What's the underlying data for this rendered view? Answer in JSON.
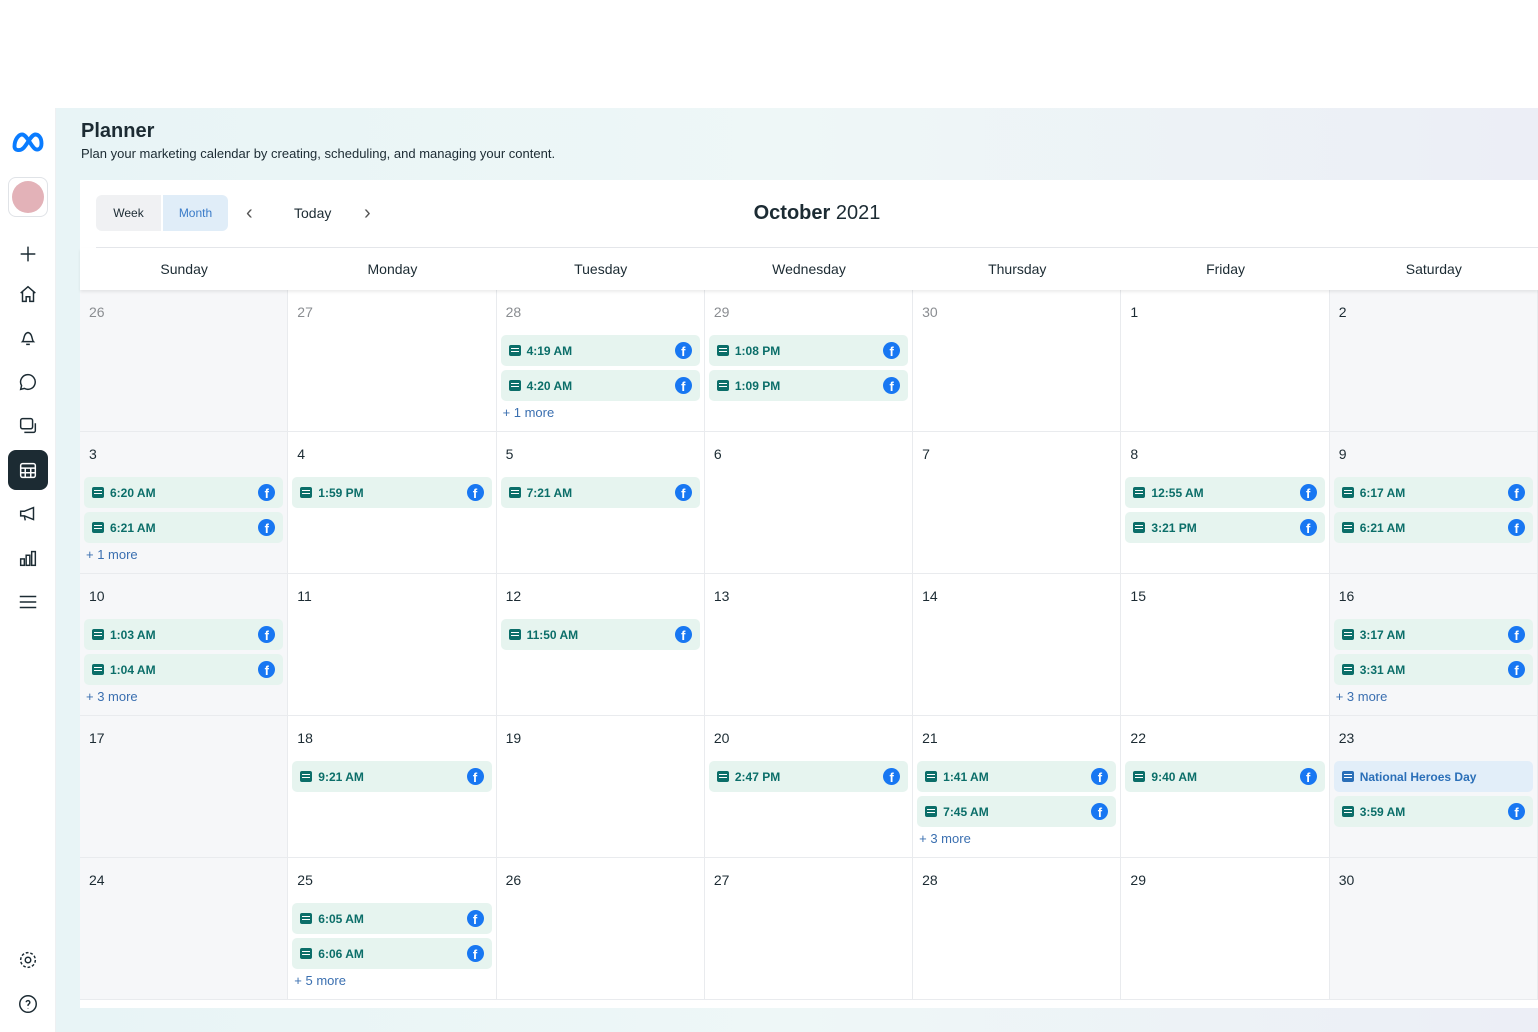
{
  "sidebar": {
    "items": [
      "meta-logo",
      "account",
      "create",
      "home",
      "notifications",
      "inbox",
      "content",
      "planner",
      "ads",
      "insights",
      "menu",
      "settings",
      "help"
    ]
  },
  "header": {
    "title": "Planner",
    "subtitle": "Plan your marketing calendar by creating, scheduling, and managing your content."
  },
  "toolbar": {
    "week": "Week",
    "month": "Month",
    "today": "Today",
    "month_name": "October",
    "year": "2021"
  },
  "days_of_week": [
    "Sunday",
    "Monday",
    "Tuesday",
    "Wednesday",
    "Thursday",
    "Friday",
    "Saturday"
  ],
  "weeks": [
    [
      {
        "d": "26",
        "m": 1
      },
      {
        "d": "27",
        "m": 1
      },
      {
        "d": "28",
        "m": 1,
        "e": [
          "4:19 AM",
          "4:20 AM"
        ],
        "more": "+ 1 more"
      },
      {
        "d": "29",
        "m": 1,
        "e": [
          "1:08 PM",
          "1:09 PM"
        ]
      },
      {
        "d": "30",
        "m": 1
      },
      {
        "d": "1"
      },
      {
        "d": "2"
      }
    ],
    [
      {
        "d": "3",
        "e": [
          "6:20 AM",
          "6:21 AM"
        ],
        "more": "+ 1 more"
      },
      {
        "d": "4",
        "e": [
          "1:59 PM"
        ]
      },
      {
        "d": "5",
        "e": [
          "7:21 AM"
        ]
      },
      {
        "d": "6"
      },
      {
        "d": "7"
      },
      {
        "d": "8",
        "e": [
          "12:55 AM",
          "3:21 PM"
        ]
      },
      {
        "d": "9",
        "e": [
          "6:17 AM",
          "6:21 AM"
        ]
      }
    ],
    [
      {
        "d": "10",
        "e": [
          "1:03 AM",
          "1:04 AM"
        ],
        "more": "+ 3 more"
      },
      {
        "d": "11"
      },
      {
        "d": "12",
        "e": [
          "11:50 AM"
        ]
      },
      {
        "d": "13"
      },
      {
        "d": "14"
      },
      {
        "d": "15"
      },
      {
        "d": "16",
        "e": [
          "3:17 AM",
          "3:31 AM"
        ],
        "more": "+ 3 more"
      }
    ],
    [
      {
        "d": "17"
      },
      {
        "d": "18",
        "e": [
          "9:21 AM"
        ]
      },
      {
        "d": "19"
      },
      {
        "d": "20",
        "e": [
          "2:47 PM"
        ]
      },
      {
        "d": "21",
        "e": [
          "1:41 AM",
          "7:45 AM"
        ],
        "more": "+ 3 more"
      },
      {
        "d": "22",
        "e": [
          "9:40 AM"
        ]
      },
      {
        "d": "23",
        "h": "National Heroes Day",
        "e": [
          "3:59 AM"
        ]
      }
    ],
    [
      {
        "d": "24"
      },
      {
        "d": "25",
        "e": [
          "6:05 AM",
          "6:06 AM"
        ],
        "more": "+ 5 more"
      },
      {
        "d": "26"
      },
      {
        "d": "27"
      },
      {
        "d": "28"
      },
      {
        "d": "29"
      },
      {
        "d": "30"
      }
    ]
  ],
  "colors": {
    "post": "#0b6e69",
    "post_bg": "#e6f4ef",
    "facebook": "#1877f2",
    "holiday": "#2a6fb8"
  }
}
